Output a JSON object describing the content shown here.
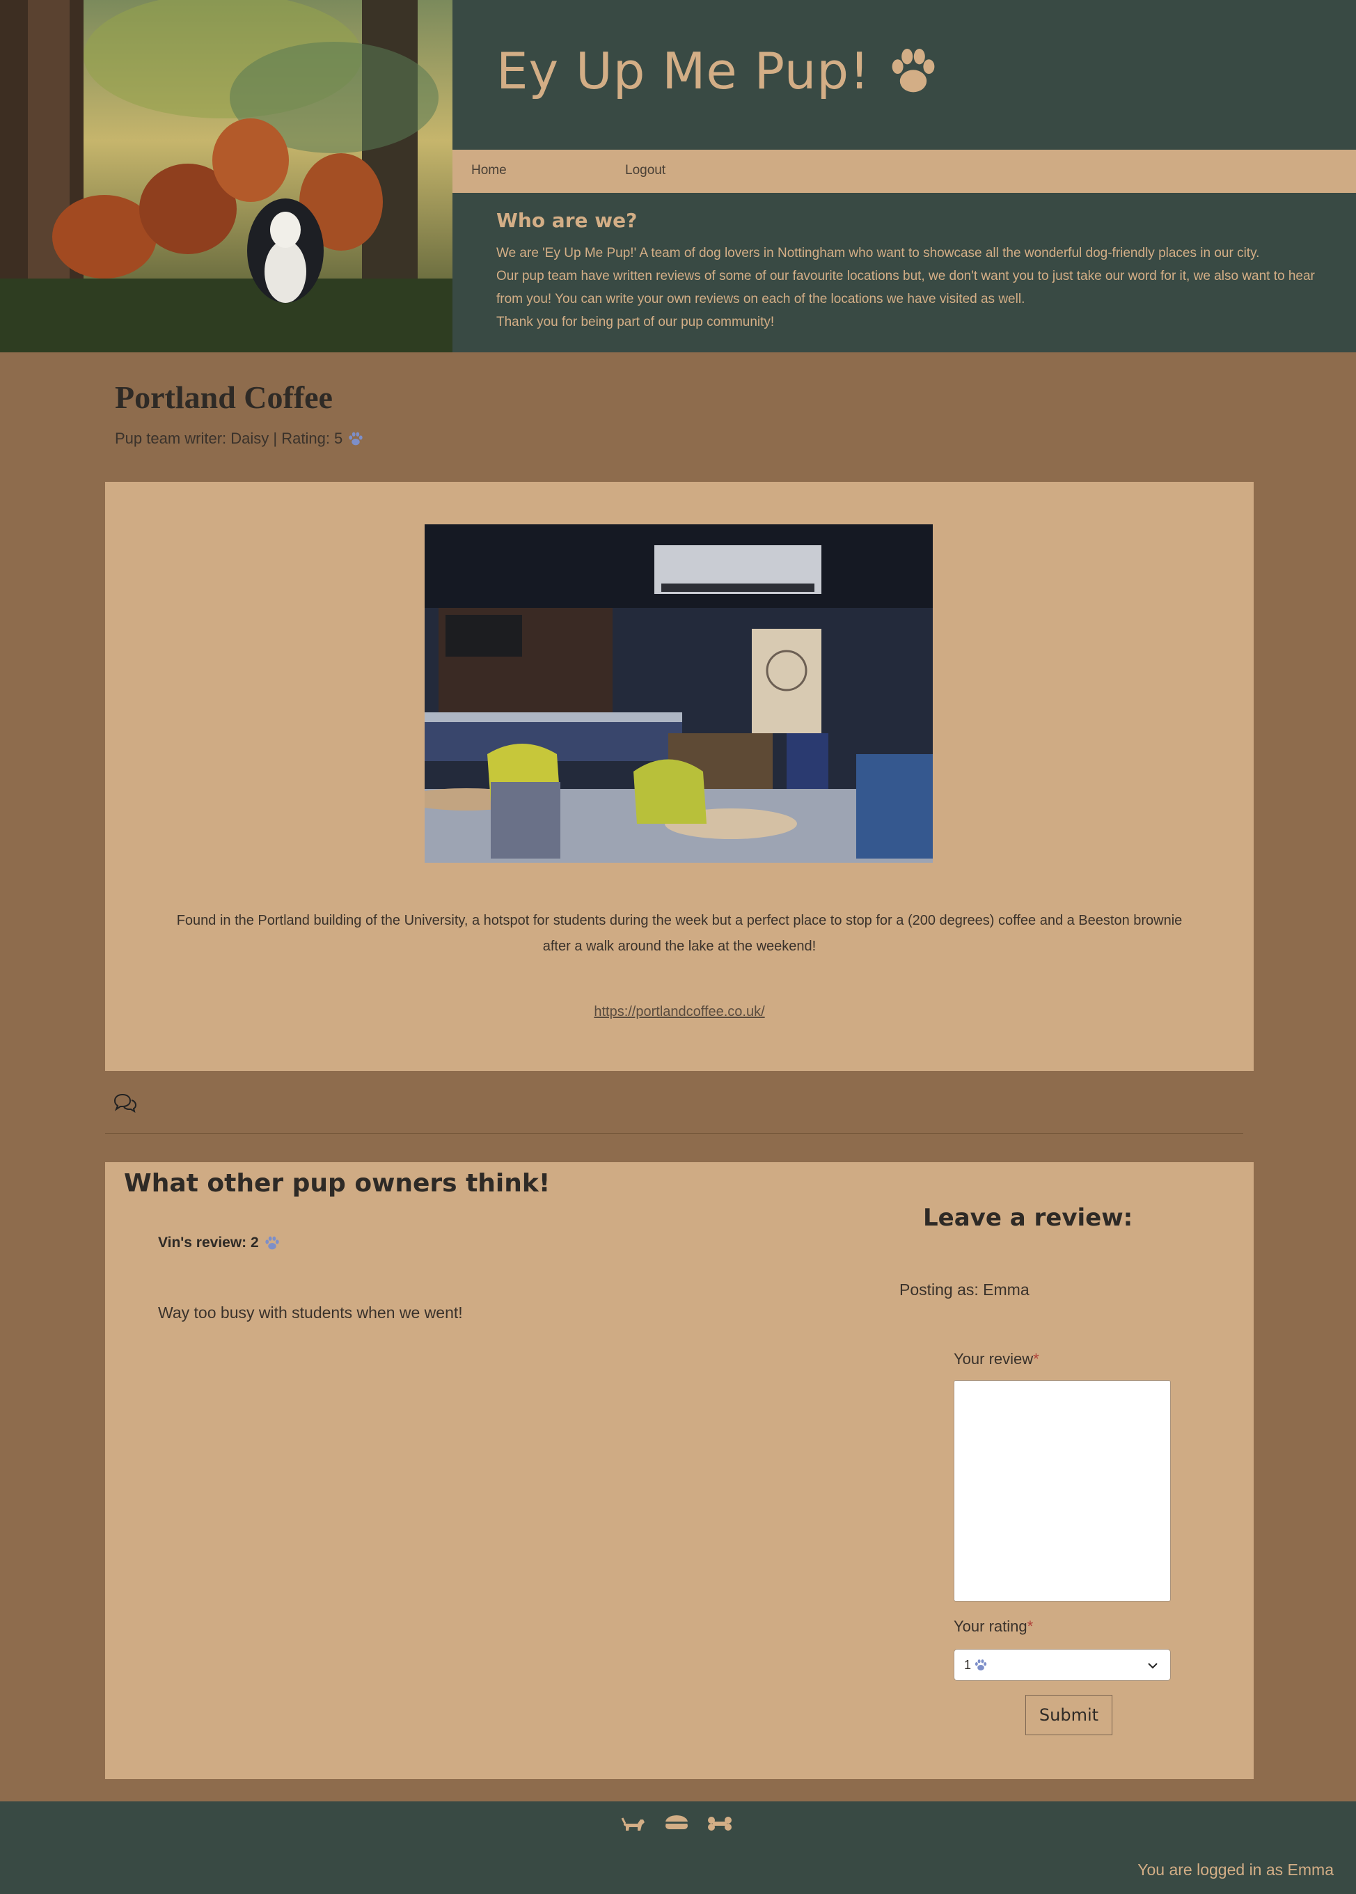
{
  "header": {
    "site_title": "Ey Up Me Pup!",
    "hero_alt": "",
    "nav": {
      "home": "Home",
      "logout": "Logout"
    },
    "about_title": "Who are we?",
    "about_lines": [
      "We are 'Ey Up Me Pup!' A team of dog lovers in Nottingham who want to showcase all the wonderful dog-friendly places in our city.",
      "Our pup team have written reviews of some of our favourite locations but, we don't want you to just take our word for it, we also want to hear from you! You can write your own reviews on each of the locations we have visited as well.",
      "Thank you for being part of our pup community!"
    ]
  },
  "post": {
    "title": "Portland Coffee",
    "meta": "Pup team writer: Daisy | Rating: 5",
    "description": "Found in the Portland building of the University, a hotspot for students during the week but a perfect place to stop for a (200 degrees) coffee and a Beeston brownie after a walk around the lake at the weekend!",
    "website": "https://portlandcoffee.co.uk/"
  },
  "reviews": {
    "title": "What other pup owners think!",
    "items": [
      {
        "author_line": "Vin's review: 2",
        "text": "Way too busy with students when we went!"
      }
    ]
  },
  "review_form": {
    "title": "Leave a review:",
    "posting_as": "Posting as: Emma",
    "review_label": "Your review",
    "rating_label": "Your rating",
    "required_mark": "*",
    "rating_selected": "1",
    "submit_label": "Submit"
  },
  "footer": {
    "icons": [
      "dog-icon",
      "food-bowl-icon",
      "bone-icon"
    ],
    "logged_in": "You are logged in as Emma"
  },
  "colors": {
    "header_bg": "#394a44",
    "accent_tan": "#cfab84",
    "page_bg": "#8e6c4d",
    "title_gold": "#d3ae86",
    "paw_purple": "#7d8fc9"
  }
}
